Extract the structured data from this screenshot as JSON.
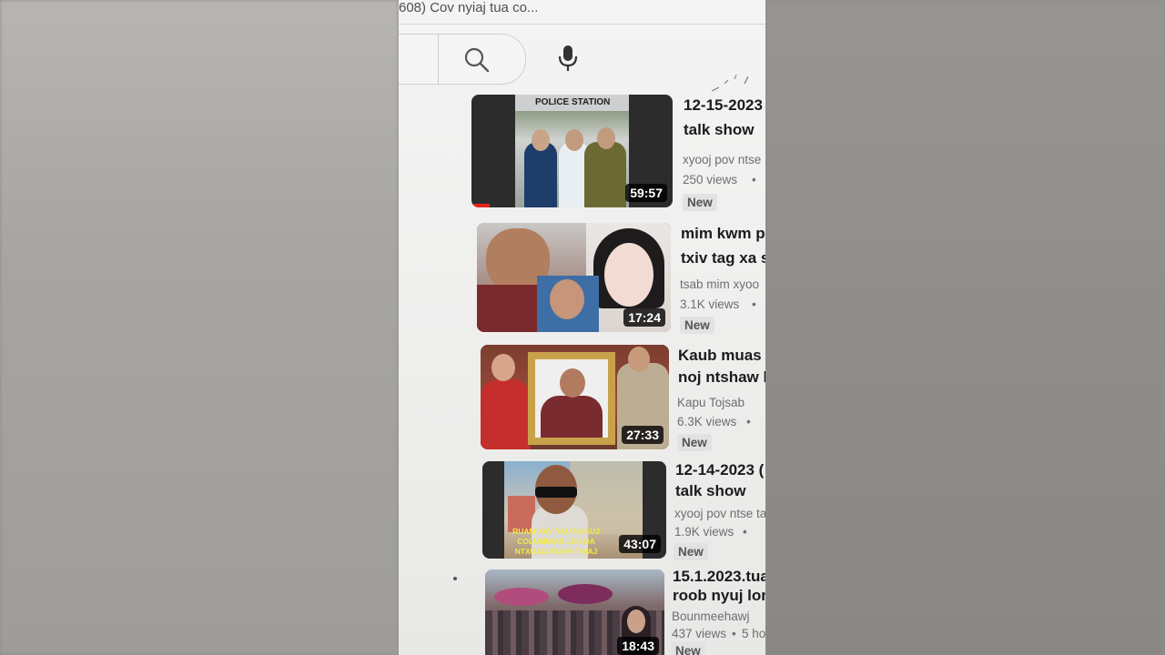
{
  "header": {
    "search_query": "608) Cov nyiaj tua co..."
  },
  "icons": {
    "search": "search-icon",
    "mic": "mic-icon"
  },
  "videos": [
    {
      "title_line1": "12-15-2023",
      "title_line2": "talk show",
      "channel": "xyooj pov ntse",
      "views": "250 views",
      "badge": "New",
      "duration": "59:57",
      "thumb_text": "POLICE STATION",
      "watched_fraction": 0.09
    },
    {
      "title_line1": "mim kwm p",
      "title_line2": "txiv tag xa s",
      "channel": "tsab mim xyoo",
      "views": "3.1K views",
      "badge": "New",
      "duration": "17:24"
    },
    {
      "title_line1": "Kaub muas p",
      "title_line2": "noj ntshaw h",
      "channel": "Kapu Tojsab",
      "views": "6.3K views",
      "badge": "New",
      "duration": "27:33"
    },
    {
      "title_line1": "12-14-2023 (",
      "title_line2": "talk show",
      "channel": "xyooj pov ntse ta",
      "views": "1.9K views",
      "badge": "New",
      "duration": "43:07",
      "thumb_text": "RUAM XAV YAU NKAUJ COLUMBIAN LES DA NTXUAG RUAM THIAJ"
    },
    {
      "title_line1": "15.1.2023.tua",
      "title_line2": "roob nyuj lom",
      "channel": "Bounmeehawj",
      "views": "437 views",
      "meta_extra": "5 ho",
      "badge": "New",
      "duration": "18:43"
    }
  ]
}
